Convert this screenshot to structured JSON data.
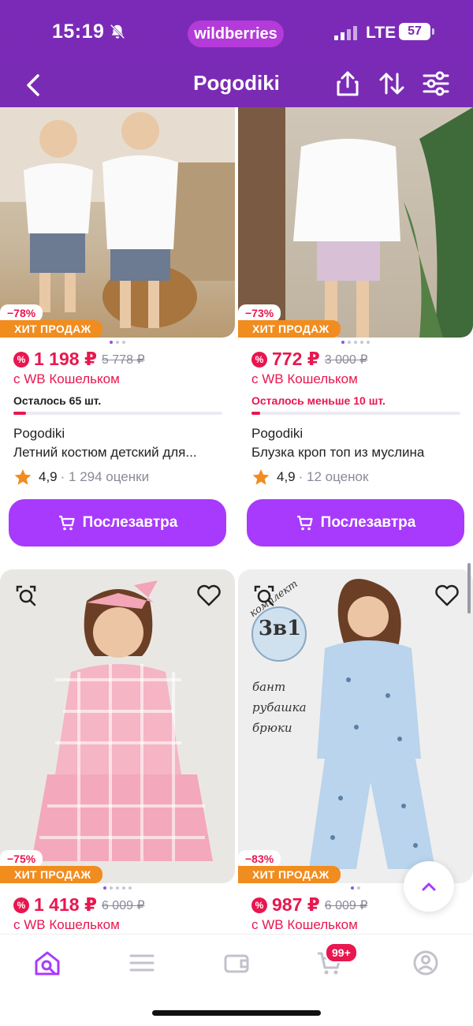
{
  "status": {
    "time": "15:19",
    "pill": "wildberries",
    "network": "LTE",
    "battery": "57"
  },
  "header": {
    "title": "Pogodiki"
  },
  "products": [
    {
      "discount": "−78%",
      "hit": "ХИТ ПРОДАЖ",
      "price": "1 198 ₽",
      "old_price": "5 778 ₽",
      "wallet": "с WB Кошельком",
      "stock": "Осталось 65 шт.",
      "brand": "Pogodiki",
      "name": "Летний костюм детский для...",
      "rating": "4,9",
      "reviews": "· 1 294 оценки",
      "button": "Послезавтра"
    },
    {
      "discount": "−73%",
      "hit": "ХИТ ПРОДАЖ",
      "price": "772 ₽",
      "old_price": "3 000 ₽",
      "wallet": "с WB Кошельком",
      "stock": "Осталось меньше 10 шт.",
      "brand": "Pogodiki",
      "name": "Блузка кроп топ из муслина",
      "rating": "4,9",
      "reviews": "· 12 оценок",
      "button": "Послезавтра"
    },
    {
      "discount": "−75%",
      "hit": "ХИТ ПРОДАЖ",
      "price": "1 418 ₽",
      "old_price": "6 009 ₽",
      "wallet": "с WB Кошельком"
    },
    {
      "discount": "−83%",
      "hit": "ХИТ ПРОДАЖ",
      "price": "987 ₽",
      "old_price": "6 009 ₽",
      "wallet": "с WB Кошельком",
      "photo_text": {
        "badge": "3в1",
        "arc": "комплект",
        "items": [
          "бант",
          "рубашка",
          "брюки"
        ]
      }
    }
  ],
  "cart_count": "99+",
  "colors": {
    "brand": "#7a2bb3",
    "accent": "#a73afd",
    "sale": "#e8174f",
    "hit": "#f18c1f"
  }
}
